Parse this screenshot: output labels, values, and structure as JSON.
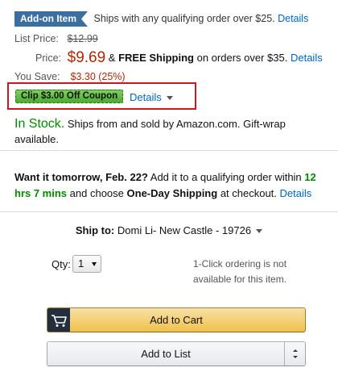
{
  "addon": {
    "badge": "Add-on Item",
    "text": "Ships with any qualifying order over $25.",
    "details_link": "Details"
  },
  "pricing": {
    "list_label": "List Price:",
    "list_value": "$12.99",
    "price_label": "Price:",
    "price_value": "$9.69",
    "shipping_amp": "&",
    "free_shipping": "FREE Shipping",
    "shipping_text": "on orders over $35.",
    "shipping_details": "Details",
    "save_label": "You Save:",
    "save_value": "$3.30 (25%)"
  },
  "coupon": {
    "badge": "Clip $3.00 Off Coupon",
    "details": "Details"
  },
  "stock": {
    "status": "In Stock.",
    "text": "Ships from and sold by Amazon.com. Gift-wrap available."
  },
  "delivery": {
    "want_bold": "Want it tomorrow, Feb. 22?",
    "text1": "Add it to a qualifying order within",
    "time": "12 hrs 7 mins",
    "text2": "and choose",
    "method": "One-Day Shipping",
    "text3": "at checkout.",
    "details": "Details"
  },
  "ship_to": {
    "label": "Ship to:",
    "address": "Domi Li- New Castle - 19726"
  },
  "qty": {
    "label": "Qty:",
    "value": "1"
  },
  "oneclick_note": "1-Click ordering is not available for this item.",
  "buttons": {
    "add_to_cart": "Add to Cart",
    "add_to_list": "Add to List"
  },
  "colors": {
    "price_red": "#b12704",
    "stock_green": "#008a00",
    "link_blue": "#0066c0",
    "highlight_red": "#d0151f",
    "cart_yellow": "#f0c14b"
  }
}
